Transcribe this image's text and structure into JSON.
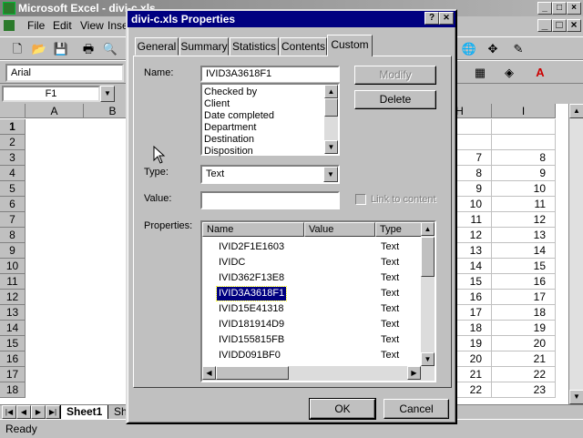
{
  "excel": {
    "title": "Microsoft Excel - divi-c.xls",
    "menu": [
      "File",
      "Edit",
      "View",
      "Inse"
    ],
    "font_name": "Arial",
    "name_box": "F1",
    "columns": [
      "A",
      "B",
      "H",
      "I"
    ],
    "rows": [
      "1",
      "2",
      "3",
      "4",
      "5",
      "6",
      "7",
      "8",
      "9",
      "10",
      "11",
      "12",
      "13",
      "14",
      "15",
      "16",
      "17",
      "18"
    ],
    "col_h": [
      "",
      "",
      "7",
      "8",
      "9",
      "10",
      "11",
      "12",
      "13",
      "14",
      "15",
      "16",
      "17",
      "18",
      "19",
      "20",
      "21",
      "22"
    ],
    "col_i": [
      "",
      "",
      "8",
      "9",
      "10",
      "11",
      "12",
      "13",
      "14",
      "15",
      "16",
      "17",
      "18",
      "19",
      "20",
      "21",
      "22",
      "23"
    ],
    "sheet_tab": "Sheet1",
    "sheet_tab_next": "Sh",
    "status": "Ready"
  },
  "dialog": {
    "title": "divi-c.xls Properties",
    "help_btn": "?",
    "close_btn": "✕",
    "tabs": [
      "General",
      "Summary",
      "Statistics",
      "Contents",
      "Custom"
    ],
    "active_tab": "Custom",
    "name_label": "Name:",
    "name_value": "IVID3A3618F1",
    "name_list": [
      "Checked by",
      "Client",
      "Date completed",
      "Department",
      "Destination",
      "Disposition"
    ],
    "modify_btn": "Modify",
    "delete_btn": "Delete",
    "type_label": "Type:",
    "type_value": "Text",
    "value_label": "Value:",
    "value_value": "",
    "link_label": "Link to content",
    "properties_label": "Properties:",
    "prop_columns": [
      "Name",
      "Value",
      "Type"
    ],
    "properties": [
      {
        "name": "IVID2F1E1603",
        "value": "",
        "type": "Text"
      },
      {
        "name": "IVIDC",
        "value": "",
        "type": "Text"
      },
      {
        "name": "IVID362F13E8",
        "value": "",
        "type": "Text"
      },
      {
        "name": "IVID3A3618F1",
        "value": "",
        "type": "Text"
      },
      {
        "name": "IVID15E41318",
        "value": "",
        "type": "Text"
      },
      {
        "name": "IVID181914D9",
        "value": "",
        "type": "Text"
      },
      {
        "name": "IVID155815FB",
        "value": "",
        "type": "Text"
      },
      {
        "name": "IVIDD091BF0",
        "value": "",
        "type": "Text"
      }
    ],
    "selected_property": "IVID3A3618F1",
    "ok_btn": "OK",
    "cancel_btn": "Cancel"
  },
  "colors": {
    "title_active": "#000080",
    "title_inactive": "#808080",
    "face": "#c0c0c0"
  }
}
